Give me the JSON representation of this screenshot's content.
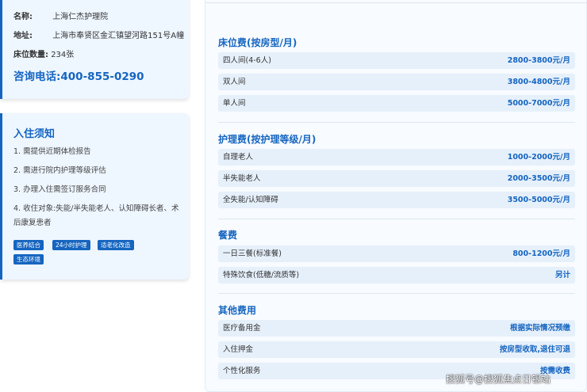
{
  "info": {
    "name_label": "名称:",
    "name_value": "上海仁杰护理院",
    "address_label": "地址:",
    "address_value": "上海市奉贤区金汇镇望河路151号A幢",
    "beds_label": "床位数量:",
    "beds_value": "234张",
    "phone_text": "咨询电话:400-855-0290"
  },
  "notice": {
    "title": "入住须知",
    "items": [
      "1. 需提供近期体检报告",
      "2. 需进行院内护理等级评估",
      "3. 办理入住需签订服务合同",
      "4. 收住对象:失能/半失能老人、认知障碍长者、术后康复患者"
    ],
    "tags": [
      "医养结合",
      "24小时护理",
      "适老化改造",
      "生态环境"
    ]
  },
  "prices": {
    "sections": [
      {
        "title": "床位费(按房型/月)",
        "rows": [
          {
            "label": "四人间(4-6人)",
            "value": "2800-3800元/月"
          },
          {
            "label": "双人间",
            "value": "3800-4800元/月"
          },
          {
            "label": "单人间",
            "value": "5000-7000元/月"
          }
        ]
      },
      {
        "title": "护理费(按护理等级/月)",
        "rows": [
          {
            "label": "自理老人",
            "value": "1000-2000元/月"
          },
          {
            "label": "半失能老人",
            "value": "2000-3500元/月"
          },
          {
            "label": "全失能/认知障碍",
            "value": "3500-5000元/月"
          }
        ]
      },
      {
        "title": "餐费",
        "rows": [
          {
            "label": "一日三餐(标准餐)",
            "value": "800-1200元/月"
          },
          {
            "label": "特殊饮食(低糖/流质等)",
            "value": "另计"
          }
        ]
      },
      {
        "title": "其他费用",
        "rows": [
          {
            "label": "医疗备用金",
            "value": "根据实际情况预缴"
          },
          {
            "label": "入住押金",
            "value": "按房型收取,退住可退"
          },
          {
            "label": "个性化服务",
            "value": "按需收费"
          }
        ]
      }
    ]
  },
  "watermark": "搜狐号@搜狐焦点日银站"
}
